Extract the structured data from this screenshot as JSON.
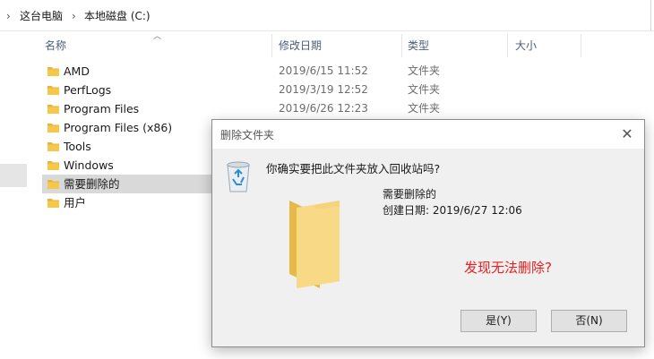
{
  "address_bar": {
    "crumbs": [
      "这台电脑",
      "本地磁盘 (C:)"
    ],
    "separator": "›"
  },
  "columns": {
    "name": "名称",
    "date": "修改日期",
    "type": "类型",
    "size": "大小"
  },
  "files": [
    {
      "name": "AMD",
      "date": "2019/6/15 11:52",
      "type": "文件夹"
    },
    {
      "name": "PerfLogs",
      "date": "2019/3/19 12:52",
      "type": "文件夹"
    },
    {
      "name": "Program Files",
      "date": "2019/6/26 12:23",
      "type": "文件夹"
    },
    {
      "name": "Program Files (x86)",
      "date": "",
      "type": ""
    },
    {
      "name": "Tools",
      "date": "",
      "type": ""
    },
    {
      "name": "Windows",
      "date": "",
      "type": ""
    },
    {
      "name": "需要删除的",
      "date": "",
      "type": "",
      "selected": true
    },
    {
      "name": "用户",
      "date": "",
      "type": ""
    }
  ],
  "dialog": {
    "title": "删除文件夹",
    "close_glyph": "✕",
    "question": "你确实要把此文件夹放入回收站吗?",
    "folder_name": "需要删除的",
    "created": "创建日期: 2019/6/27 12:06",
    "annotation": "发现无法删除?",
    "yes_label": "是(Y)",
    "no_label": "否(N)"
  },
  "colors": {
    "folder": "#f5c84c",
    "annotation": "#e81f1f",
    "selection": "#d9d9d9"
  }
}
